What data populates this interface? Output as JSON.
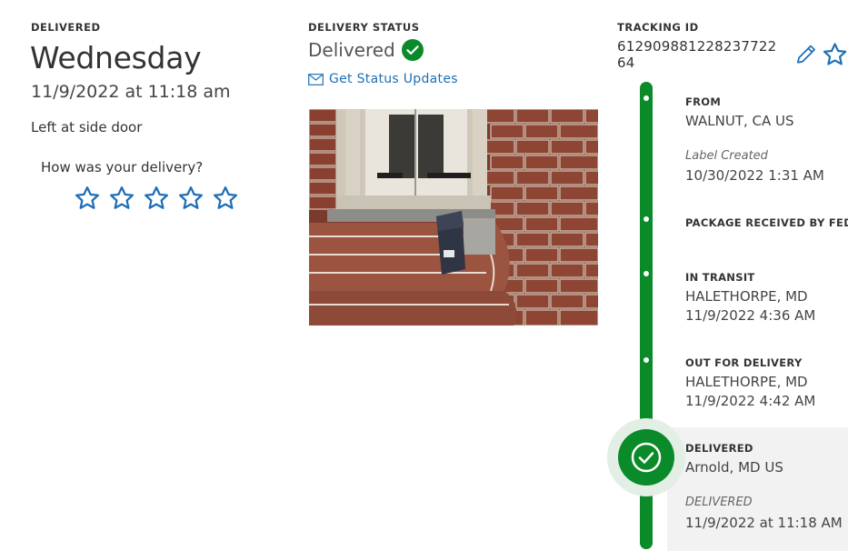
{
  "left": {
    "label": "DELIVERED",
    "day": "Wednesday",
    "datetime": "11/9/2022 at 11:18 am",
    "location_note": "Left at side door",
    "rating_question": "How was your delivery?",
    "stars": 5,
    "star_icon": "star-outline-icon"
  },
  "status": {
    "label": "DELIVERY STATUS",
    "value": "Delivered",
    "updates_link": "Get Status Updates",
    "photo_alt": "Package left on brick steps"
  },
  "tracking": {
    "label": "TRACKING ID",
    "id": "612909881228237722​64"
  },
  "timeline": [
    {
      "title": "FROM",
      "lines": [
        "WALNUT, CA US"
      ],
      "italic": "Label Created",
      "sub": "10/30/2022 1:31 AM"
    },
    {
      "title": "PACKAGE RECEIVED BY FEDEX"
    },
    {
      "title": "IN TRANSIT",
      "lines": [
        "HALETHORPE, MD",
        "11/9/2022 4:36 AM"
      ]
    },
    {
      "title": "OUT FOR DELIVERY",
      "lines": [
        "HALETHORPE, MD",
        "11/9/2022 4:42 AM"
      ]
    },
    {
      "title": "DELIVERED",
      "lines": [
        "Arnold, MD US"
      ],
      "italic": "DELIVERED",
      "sub": "11/9/2022 at 11:18 AM"
    }
  ],
  "colors": {
    "accent_green": "#0b8a2a",
    "link_blue": "#1f6fb5",
    "icon_blue": "#1f6fb5"
  }
}
